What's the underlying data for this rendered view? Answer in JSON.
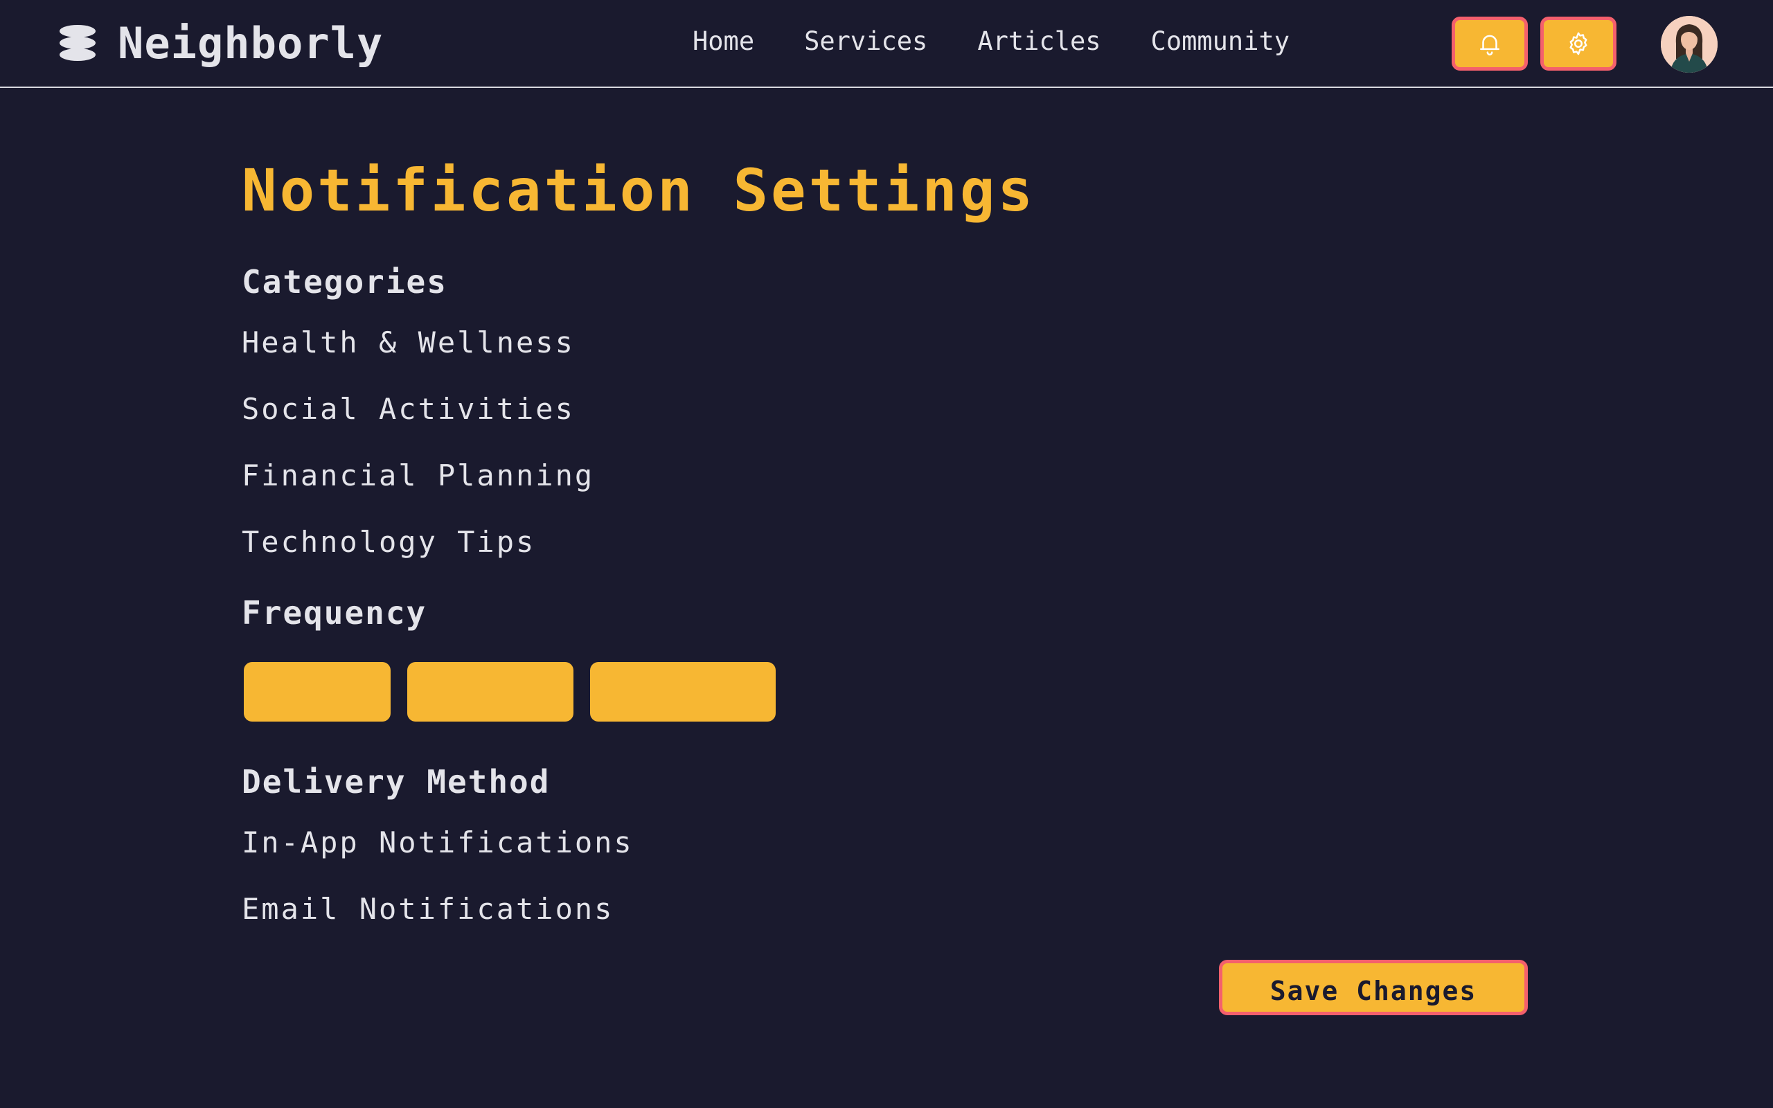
{
  "header": {
    "brand_name": "Neighborly",
    "brand_icon": "stacked-layers-icon",
    "nav": [
      {
        "label": "Home"
      },
      {
        "label": "Services"
      },
      {
        "label": "Articles"
      },
      {
        "label": "Community"
      }
    ],
    "notification_icon": "bell-icon",
    "settings_icon": "gear-icon",
    "avatar": "user-avatar"
  },
  "main": {
    "title": "Notification Settings",
    "categories": {
      "heading": "Categories",
      "items": [
        {
          "label": "Health & Wellness"
        },
        {
          "label": "Social Activities"
        },
        {
          "label": "Financial Planning"
        },
        {
          "label": "Technology Tips"
        }
      ]
    },
    "frequency": {
      "heading": "Frequency",
      "options": [
        {
          "label": ""
        },
        {
          "label": ""
        },
        {
          "label": ""
        }
      ]
    },
    "delivery": {
      "heading": "Delivery Method",
      "items": [
        {
          "label": "In-App Notifications"
        },
        {
          "label": "Email Notifications"
        }
      ]
    },
    "save_label": "Save Changes"
  },
  "colors": {
    "background": "#1a1a2e",
    "accent": "#f7b733",
    "accent_border": "#f4606c",
    "text": "#e4e4ea"
  }
}
